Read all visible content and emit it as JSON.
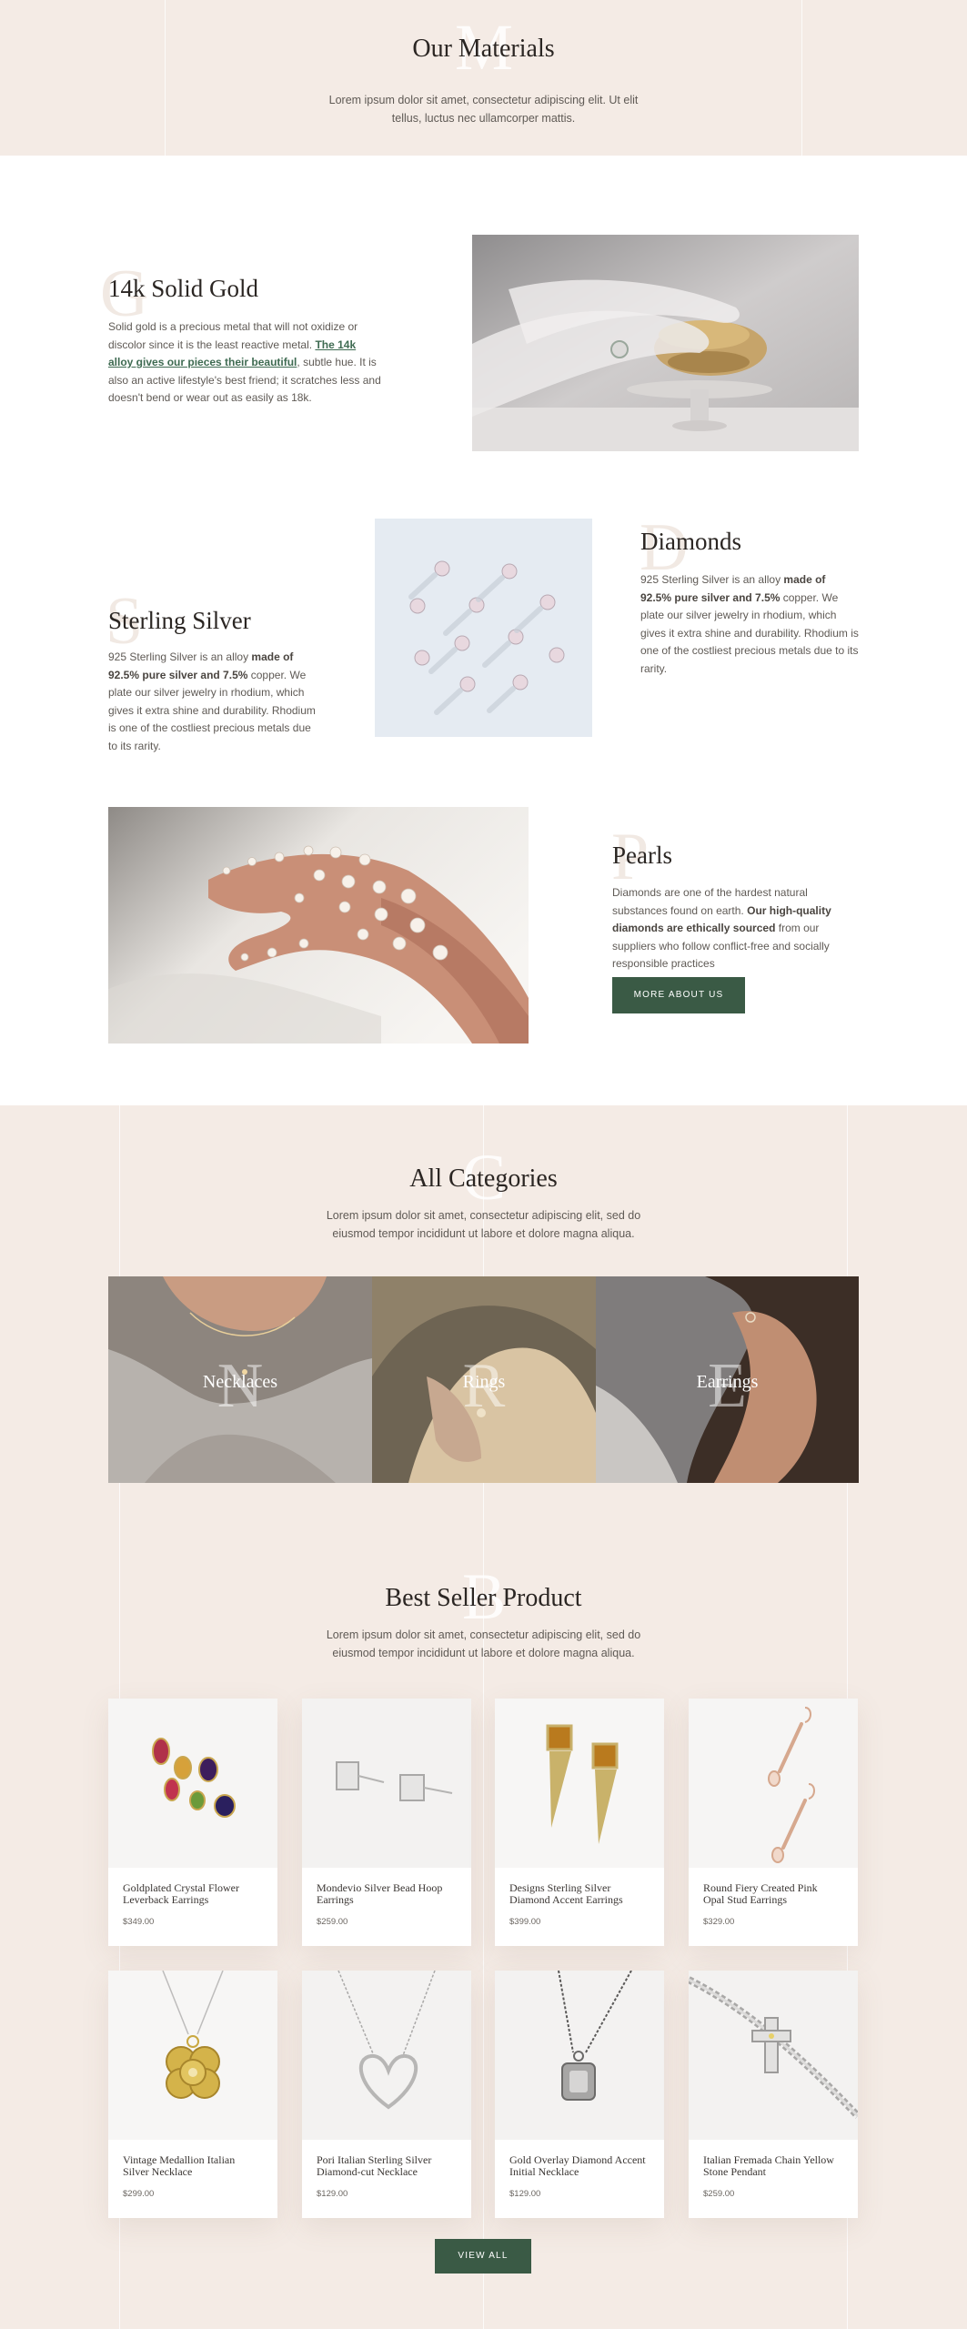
{
  "materials": {
    "title": "Our Materials",
    "ghost_letter": "M",
    "desc_line1": "Lorem ipsum dolor sit amet, consectetur adipiscing elit. Ut elit",
    "desc_line2": "tellus, luctus nec ullamcorper mattis."
  },
  "gold": {
    "ghost_letter": "G",
    "title": "14k Solid Gold",
    "text_1": "Solid gold is a precious metal that will not oxidize or discolor since it is the least reactive metal. ",
    "text_link": "The 14k alloy gives our pieces their beautiful",
    "text_2": ", subtle hue. It is also an active lifestyle's best friend; it scratches less and doesn't bend or wear out as easily as 18k."
  },
  "silver": {
    "ghost_letter": "S",
    "title": "Sterling Silver",
    "text_1": "925 Sterling Silver is an alloy ",
    "text_bold": "made of 92.5% pure silver and 7.5%",
    "text_2": " copper. We plate our silver jewelry in rhodium, which gives it extra shine and durability. Rhodium is one of the costliest precious metals due to its rarity."
  },
  "diamonds": {
    "ghost_letter": "D",
    "title": "Diamonds",
    "text_1": "925 Sterling Silver is an alloy ",
    "text_bold": "made of 92.5% pure silver and 7.5%",
    "text_2": " copper. We plate our silver jewelry in rhodium, which gives it extra shine and durability. Rhodium is one of the costliest precious metals due to its rarity."
  },
  "pearls": {
    "ghost_letter": "P",
    "title": "Pearls",
    "text_1": "Diamonds are one of the hardest natural substances found on earth. ",
    "text_bold": "Our high-quality diamonds are ethically sourced",
    "text_2": " from our suppliers who follow conflict-free and socially responsible practices",
    "button_label": "MORE ABOUT US"
  },
  "categories": {
    "ghost_letter": "C",
    "title": "All Categories",
    "desc_line1": "Lorem ipsum dolor sit amet, consectetur adipiscing elit, sed do",
    "desc_line2": "eiusmod tempor incididunt ut labore et dolore magna aliqua.",
    "items": [
      {
        "label": "Necklaces",
        "letter": "N"
      },
      {
        "label": "Rings",
        "letter": "R"
      },
      {
        "label": "Earrings",
        "letter": "E"
      }
    ]
  },
  "bestseller": {
    "ghost_letter": "B",
    "title": "Best Seller Product",
    "desc_line1": "Lorem ipsum dolor sit amet, consectetur adipiscing elit, sed do",
    "desc_line2": "eiusmod tempor incididunt ut labore et dolore magna aliqua.",
    "button_label": "VIEW ALL",
    "products": [
      {
        "name": "Goldplated Crystal Flower Leverback Earrings",
        "price": "$349.00"
      },
      {
        "name": "Mondevio Silver Bead Hoop Earrings",
        "price": "$259.00"
      },
      {
        "name": "Designs Sterling Silver Diamond Accent Earrings",
        "price": "$399.00"
      },
      {
        "name": "Round Fiery Created Pink Opal Stud Earrings",
        "price": "$329.00"
      },
      {
        "name": "Vintage Medallion Italian Silver Necklace",
        "price": "$299.00"
      },
      {
        "name": "Pori Italian Sterling Silver Diamond-cut Necklace",
        "price": "$129.00"
      },
      {
        "name": "Gold Overlay Diamond Accent Initial Necklace",
        "price": "$129.00"
      },
      {
        "name": "Italian Fremada Chain Yellow Stone Pendant",
        "price": "$259.00"
      }
    ]
  },
  "colors": {
    "beige": "#f4ebe5",
    "accent_green": "#3a5a45",
    "heading": "#2b2623"
  }
}
